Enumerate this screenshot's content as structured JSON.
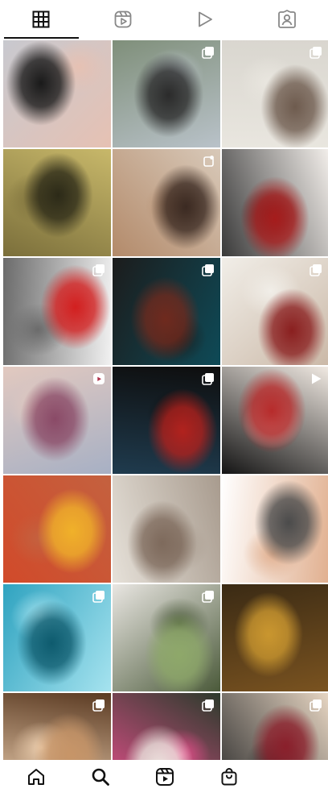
{
  "profile_tabs": [
    {
      "icon": "grid-icon",
      "selected": true
    },
    {
      "icon": "reels-icon",
      "selected": false
    },
    {
      "icon": "play-icon",
      "selected": false
    },
    {
      "icon": "tagged-person-icon",
      "selected": false
    }
  ],
  "posts": [
    {
      "colors": [
        "#c8c9cf",
        "#1a1a1a",
        "#e6c1b3"
      ],
      "badge": "none"
    },
    {
      "colors": [
        "#7f8f7a",
        "#2b2b2b",
        "#b9c2c9"
      ],
      "badge": "carousel"
    },
    {
      "colors": [
        "#d9d6cf",
        "#6e5b4e",
        "#e9e6df"
      ],
      "badge": "carousel"
    },
    {
      "colors": [
        "#c8b86a",
        "#2c2a18",
        "#7b6f3b"
      ],
      "badge": "none"
    },
    {
      "colors": [
        "#d8c9b9",
        "#3b2a22",
        "#b38a6a"
      ],
      "badge": "clip"
    },
    {
      "colors": [
        "#f1ede9",
        "#a61c1c",
        "#3a3a3a"
      ],
      "badge": "none"
    },
    {
      "colors": [
        "#f1f1f1",
        "#d31f1f",
        "#6b6b6b"
      ],
      "badge": "carousel"
    },
    {
      "colors": [
        "#0e4a57",
        "#6f2a1e",
        "#1c1c1c"
      ],
      "badge": "carousel"
    },
    {
      "colors": [
        "#cbb9a8",
        "#8a1f1f",
        "#f1eee8"
      ],
      "badge": "carousel"
    },
    {
      "colors": [
        "#a7b0c4",
        "#8a4a67",
        "#e2c9c0"
      ],
      "badge": "reel"
    },
    {
      "colors": [
        "#1f3b4e",
        "#b1221e",
        "#0e0e0e"
      ],
      "badge": "carousel"
    },
    {
      "colors": [
        "#141414",
        "#b72b2b",
        "#f0e9e2"
      ],
      "badge": "video"
    },
    {
      "colors": [
        "#d14a2a",
        "#f0b12a",
        "#c4613f"
      ],
      "badge": "none"
    },
    {
      "colors": [
        "#e6e1d9",
        "#7e6a5c",
        "#a89b8e"
      ],
      "badge": "none"
    },
    {
      "colors": [
        "#ffffff",
        "#4b4b4b",
        "#e1b090"
      ],
      "badge": "none"
    },
    {
      "colors": [
        "#2fa3c0",
        "#0e5b6e",
        "#a6e3ef"
      ],
      "badge": "carousel"
    },
    {
      "colors": [
        "#e9e6e2",
        "#8ea86a",
        "#4b5a3a"
      ],
      "badge": "carousel"
    },
    {
      "colors": [
        "#3a2a14",
        "#c9962f",
        "#7a5320"
      ],
      "badge": "none"
    },
    {
      "colors": [
        "#5a3a22",
        "#c79568",
        "#f0d2b2"
      ],
      "badge": "carousel"
    },
    {
      "colors": [
        "#2c3b2c",
        "#ece3de",
        "#e64f8c"
      ],
      "badge": "carousel"
    },
    {
      "colors": [
        "#e6d5c2",
        "#8a1f2b",
        "#2d2d2d"
      ],
      "badge": "carousel"
    }
  ],
  "bottom_nav": [
    {
      "icon": "home-icon"
    },
    {
      "icon": "search-icon"
    },
    {
      "icon": "reels-icon"
    },
    {
      "icon": "shop-bag-icon"
    }
  ]
}
